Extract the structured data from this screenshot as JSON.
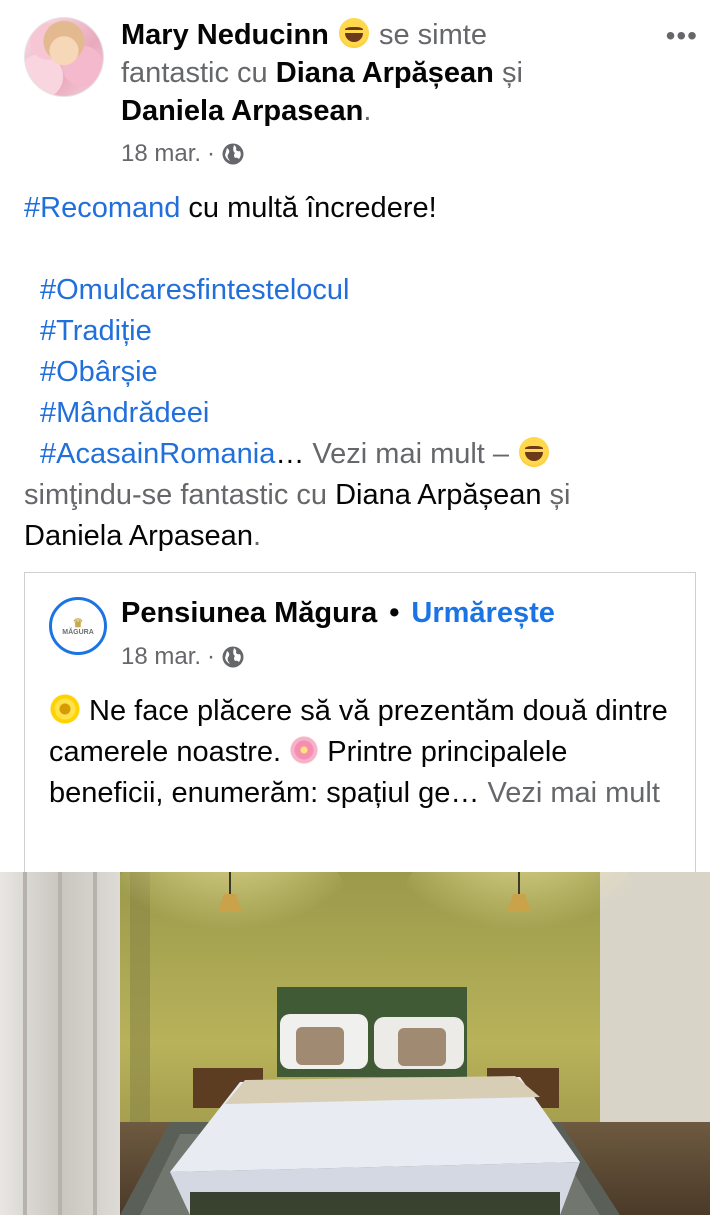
{
  "post": {
    "author": "Mary Neducinn",
    "feeling_text": "se simte fantastic cu",
    "tagged_1": "Diana Arpășean",
    "and_word": "și",
    "tagged_2": "Daniela Arpasean",
    "period": ".",
    "date": "18 mar.",
    "separator": "·",
    "more_menu": "•••"
  },
  "body": {
    "line1_tag": "#Recomand",
    "line1_text": " cu multă încredere!",
    "hashtags": [
      "#Omulcaresfintestelocul",
      "#Tradiție",
      "#Obârșie",
      "#Mândrădeei"
    ],
    "last_tag": "#AcasainRomania",
    "ellipsis": "…",
    "see_more": " Vezi mai mult",
    "dash": " – ",
    "feeling_text": "simţindu-se fantastic cu ",
    "tagged_1": "Diana Arpășean",
    "and_word": " și",
    "tagged_2": "Daniela Arpasean",
    "period": "."
  },
  "shared": {
    "page_name": "Pensiunea Măgura",
    "dot": "•",
    "follow": "Urmărește",
    "date": "18 mar.",
    "separator": "·",
    "logo_text": "MĂGURA",
    "text_1": " Ne face plăcere să vă prezentăm două dintre camerele noastre. ",
    "text_2": " Printre principalele beneficii, enumerăm: spațiul ge…",
    "see_more": " Vezi mai mult"
  },
  "icons": {
    "globe": "globe-icon",
    "laugh": "grinning-squinting-face-icon",
    "sunflower": "sunflower-icon",
    "blossom": "cherry-blossom-icon"
  },
  "colors": {
    "link": "#216fdb",
    "follow": "#1b74e4",
    "secondary": "#65676b"
  }
}
